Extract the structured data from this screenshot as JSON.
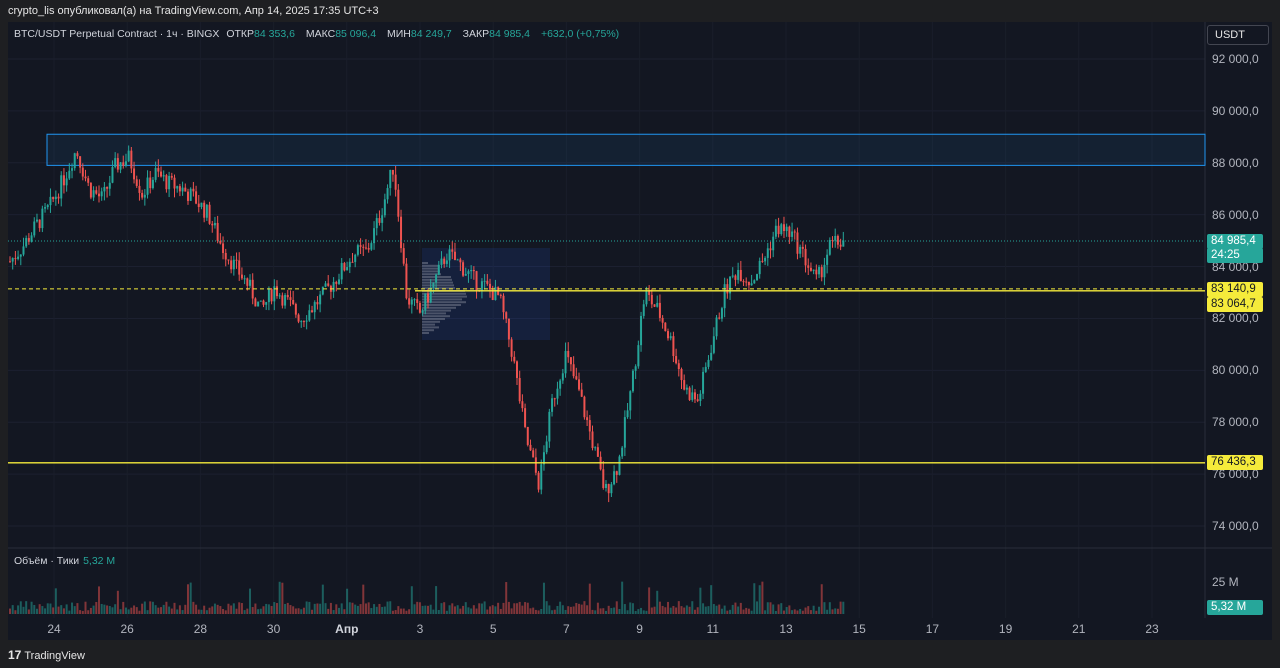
{
  "header": {
    "publisher_line": "crypto_lis опубликовал(а) на TradingView.com, Апр 14, 2025 17:35 UTC+3"
  },
  "legend": {
    "symbol": "BTC/USDT Perpetual Contract · 1ч · BINGX",
    "open_label": "ОТКР",
    "open_value": "84 353,6",
    "high_label": "МАКС",
    "high_value": "85 096,4",
    "low_label": "МИН",
    "low_value": "84 249,7",
    "close_label": "ЗАКР",
    "close_value": "84 985,4",
    "change": "+632,0 (+0,75%)"
  },
  "currency_button": "USDT",
  "price_axis": {
    "ticks": [
      "92 000,0",
      "90 000,0",
      "88 000,0",
      "86 000,0",
      "84 000,0",
      "82 000,0",
      "80 000,0",
      "78 000,0",
      "76 000,0",
      "74 000,0"
    ],
    "tick_values": [
      92000,
      90000,
      88000,
      86000,
      84000,
      82000,
      80000,
      78000,
      76000,
      74000
    ]
  },
  "price_labels": {
    "current_price": "84 985,4",
    "countdown": "24:25",
    "level_1": "83 140,9",
    "level_2": "83 064,7",
    "level_3": "76 436,3"
  },
  "time_axis": {
    "ticks": [
      "24",
      "26",
      "28",
      "30",
      "Апр",
      "3",
      "5",
      "7",
      "9",
      "11",
      "13",
      "15",
      "17",
      "19",
      "21",
      "23"
    ]
  },
  "volume": {
    "label": "Объём · Тики",
    "value": "5,32 M",
    "axis_tick": "25 M",
    "current_label": "5,32 M"
  },
  "footer": {
    "brand": "TradingView",
    "logo_glyph": "17"
  },
  "colors": {
    "up": "#26a69a",
    "down": "#ef5350",
    "level_line": "#f5eb3b",
    "zone_border": "#2196f3",
    "background": "#131722"
  },
  "chart_data": {
    "type": "candlestick",
    "symbol": "BTC/USDT Perpetual Contract",
    "interval": "1ч",
    "ylim": [
      73000,
      93000
    ],
    "levels": [
      83140.9,
      83064.7,
      76436.3
    ],
    "resistance_zone": [
      87900,
      89100
    ],
    "price_path": [
      [
        84200,
        84800
      ],
      [
        85600,
        86300
      ],
      [
        87300,
        88500
      ],
      [
        87000,
        86600
      ],
      [
        87900,
        88200
      ],
      [
        86800,
        87600
      ],
      [
        87200,
        87000
      ],
      [
        86600,
        86000
      ],
      [
        84800,
        84000
      ],
      [
        83300,
        82300
      ],
      [
        83200,
        82600
      ],
      [
        82000,
        82500
      ],
      [
        83100,
        83800
      ],
      [
        84500,
        84600
      ],
      [
        86000,
        87900
      ],
      [
        82800,
        82200
      ],
      [
        83300,
        84500
      ],
      [
        84100,
        83500
      ],
      [
        83200,
        82800
      ],
      [
        80600,
        77400
      ],
      [
        75600,
        78800
      ],
      [
        80600,
        79200
      ],
      [
        77300,
        75300
      ],
      [
        76400,
        79400
      ],
      [
        83000,
        82300
      ],
      [
        81100,
        79300
      ],
      [
        78800,
        80900
      ],
      [
        83000,
        83900
      ],
      [
        83400,
        84300
      ],
      [
        85500,
        85300
      ],
      [
        84400,
        83400
      ],
      [
        84800,
        84985.4
      ]
    ],
    "volume_peak_label": "25 M",
    "last_volume": "5,32 M"
  }
}
